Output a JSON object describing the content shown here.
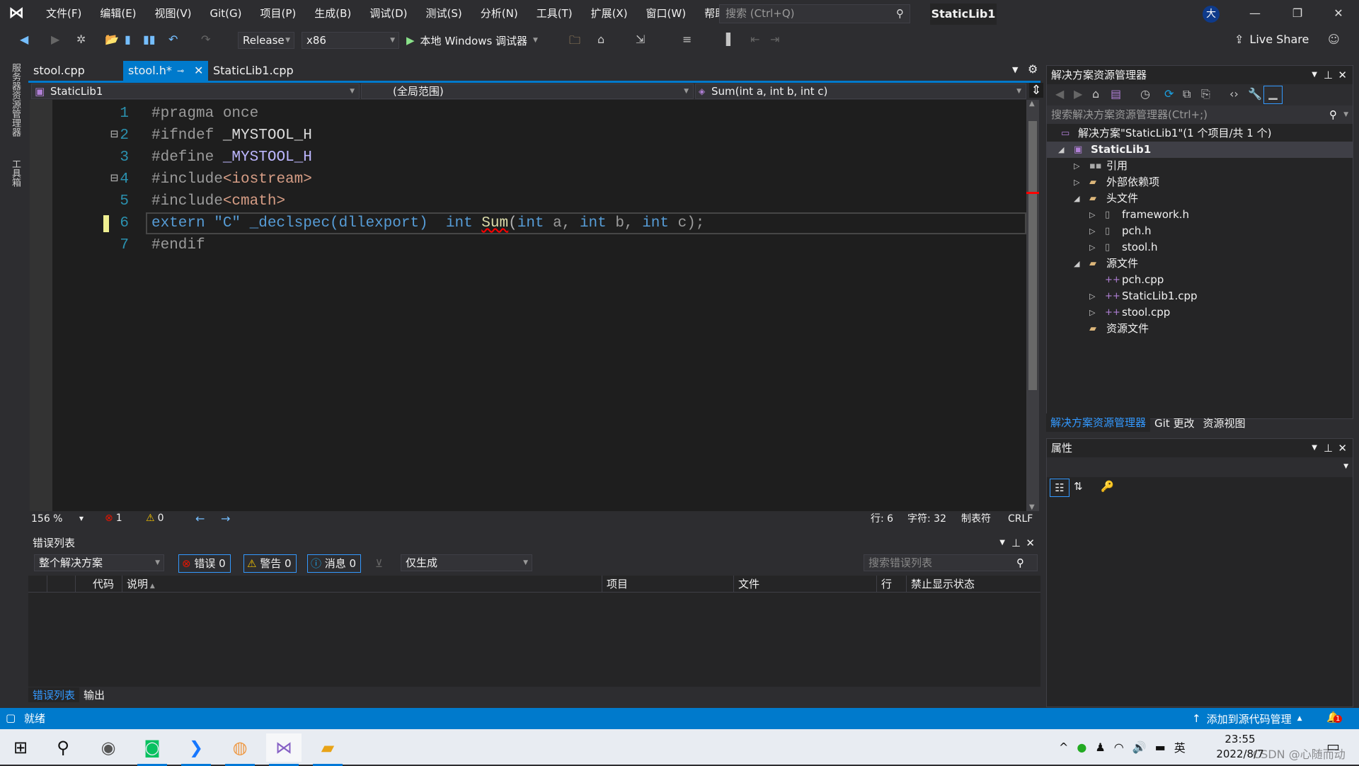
{
  "window": {
    "project_name": "StaticLib1",
    "avatar": "大",
    "search_placeholder": "搜索 (Ctrl+Q)"
  },
  "menu": [
    "文件(F)",
    "编辑(E)",
    "视图(V)",
    "Git(G)",
    "项目(P)",
    "生成(B)",
    "调试(D)",
    "测试(S)",
    "分析(N)",
    "工具(T)",
    "扩展(X)",
    "窗口(W)",
    "帮助(H)"
  ],
  "toolbar": {
    "configuration": "Release",
    "platform": "x86",
    "debugger": "本地 Windows 调试器",
    "live_share": "Live Share"
  },
  "left_strip": [
    "服务器资源管理器",
    "工具箱"
  ],
  "doc_tabs": [
    {
      "label": "stool.cpp",
      "active": false
    },
    {
      "label": "stool.h*",
      "active": true
    },
    {
      "label": "StaticLib1.cpp",
      "active": false
    }
  ],
  "nav": {
    "project": "StaticLib1",
    "scope": "(全局范围)",
    "member": "Sum(int a, int b, int c)"
  },
  "code": {
    "current_line": 6,
    "lines": [
      {
        "n": "1",
        "tokens": [
          {
            "t": "#pragma once",
            "c": "#9b9b9b"
          }
        ]
      },
      {
        "n": "2",
        "fold": true,
        "tokens": [
          {
            "t": "#ifndef ",
            "c": "#9b9b9b"
          },
          {
            "t": "_MYSTOOL_H",
            "c": "#dcdcdc"
          }
        ]
      },
      {
        "n": "3",
        "tokens": [
          {
            "t": "#define ",
            "c": "#9b9b9b"
          },
          {
            "t": "_MYSTOOL_H",
            "c": "#bdb7ff"
          }
        ]
      },
      {
        "n": "4",
        "fold": true,
        "tokens": [
          {
            "t": "#include",
            "c": "#9b9b9b"
          },
          {
            "t": "<iostream>",
            "c": "#d69d85"
          }
        ]
      },
      {
        "n": "5",
        "tokens": [
          {
            "t": "#include",
            "c": "#9b9b9b"
          },
          {
            "t": "<cmath>",
            "c": "#d69d85"
          }
        ]
      },
      {
        "n": "6",
        "tokens": [
          {
            "t": "extern \"C\" _declspec(dllexport)",
            "c": "#569cd6"
          },
          {
            "t": "  int ",
            "c": "#569cd6"
          },
          {
            "t": "Sum",
            "c": "#dcdcaa",
            "squiggle": true
          },
          {
            "t": "(",
            "c": "#b4b4b4"
          },
          {
            "t": "int",
            "c": "#569cd6"
          },
          {
            "t": " a, ",
            "c": "#9a9a9a"
          },
          {
            "t": "int",
            "c": "#569cd6"
          },
          {
            "t": " b, ",
            "c": "#9a9a9a"
          },
          {
            "t": "int",
            "c": "#569cd6"
          },
          {
            "t": " c);",
            "c": "#9a9a9a"
          }
        ]
      },
      {
        "n": "7",
        "tokens": [
          {
            "t": "#endif",
            "c": "#9b9b9b"
          }
        ]
      }
    ]
  },
  "editor_status": {
    "zoom": "156 %",
    "errors": "1",
    "warnings": "0",
    "line": "行: 6",
    "char": "字符: 32",
    "tabs": "制表符",
    "eol": "CRLF"
  },
  "error_list": {
    "title": "错误列表",
    "scope": "整个解决方案",
    "errors_btn": "错误 0",
    "warnings_btn": "警告 0",
    "messages_btn": "消息 0",
    "build_filter": "仅生成",
    "search_placeholder": "搜索错误列表",
    "columns": [
      "代码",
      "说明",
      "项目",
      "文件",
      "行",
      "禁止显示状态"
    ]
  },
  "bottom_tabs": [
    {
      "label": "错误列表",
      "active": true
    },
    {
      "label": "输出",
      "active": false
    }
  ],
  "solution_explorer": {
    "title": "解决方案资源管理器",
    "search_placeholder": "搜索解决方案资源管理器(Ctrl+;)",
    "tree": [
      {
        "label": "解决方案\"StaticLib1\"(1 个项目/共 1 个)",
        "level": 0,
        "toggle": "",
        "icon": "solution-icon"
      },
      {
        "label": "StaticLib1",
        "level": 0,
        "toggle": "expanded",
        "icon": "project-icon",
        "selected": true
      },
      {
        "label": "引用",
        "level": 1,
        "toggle": "collapsed",
        "icon": "references-icon"
      },
      {
        "label": "外部依赖项",
        "level": 1,
        "toggle": "collapsed",
        "icon": "folder-icon"
      },
      {
        "label": "头文件",
        "level": 1,
        "toggle": "expanded",
        "icon": "filter-folder-icon"
      },
      {
        "label": "framework.h",
        "level": 2,
        "toggle": "collapsed",
        "icon": "header-file-icon"
      },
      {
        "label": "pch.h",
        "level": 2,
        "toggle": "collapsed",
        "icon": "header-file-icon"
      },
      {
        "label": "stool.h",
        "level": 2,
        "toggle": "collapsed",
        "icon": "header-file-icon"
      },
      {
        "label": "源文件",
        "level": 1,
        "toggle": "expanded",
        "icon": "filter-folder-icon"
      },
      {
        "label": "pch.cpp",
        "level": 2,
        "toggle": "",
        "icon": "cpp-file-icon"
      },
      {
        "label": "StaticLib1.cpp",
        "level": 2,
        "toggle": "collapsed",
        "icon": "cpp-file-icon"
      },
      {
        "label": "stool.cpp",
        "level": 2,
        "toggle": "collapsed",
        "icon": "cpp-file-icon"
      },
      {
        "label": "资源文件",
        "level": 1,
        "toggle": "",
        "icon": "filter-folder-icon"
      }
    ]
  },
  "right_tabs": [
    {
      "label": "解决方案资源管理器",
      "active": true
    },
    {
      "label": "Git 更改",
      "active": false
    },
    {
      "label": "资源视图",
      "active": false
    }
  ],
  "properties": {
    "title": "属性"
  },
  "statusbar": {
    "ready": "就绪",
    "source_control": "添加到源代码管理",
    "notifications": "1"
  },
  "taskbar": {
    "time": "23:55",
    "date": "2022/8/7",
    "ime": "英",
    "watermark": "CSDN @心随而动"
  },
  "colors": {
    "accent": "#007acc",
    "editor_bg": "#1e1e1e",
    "keyword": "#569cd6",
    "line_number": "#2b91af"
  }
}
